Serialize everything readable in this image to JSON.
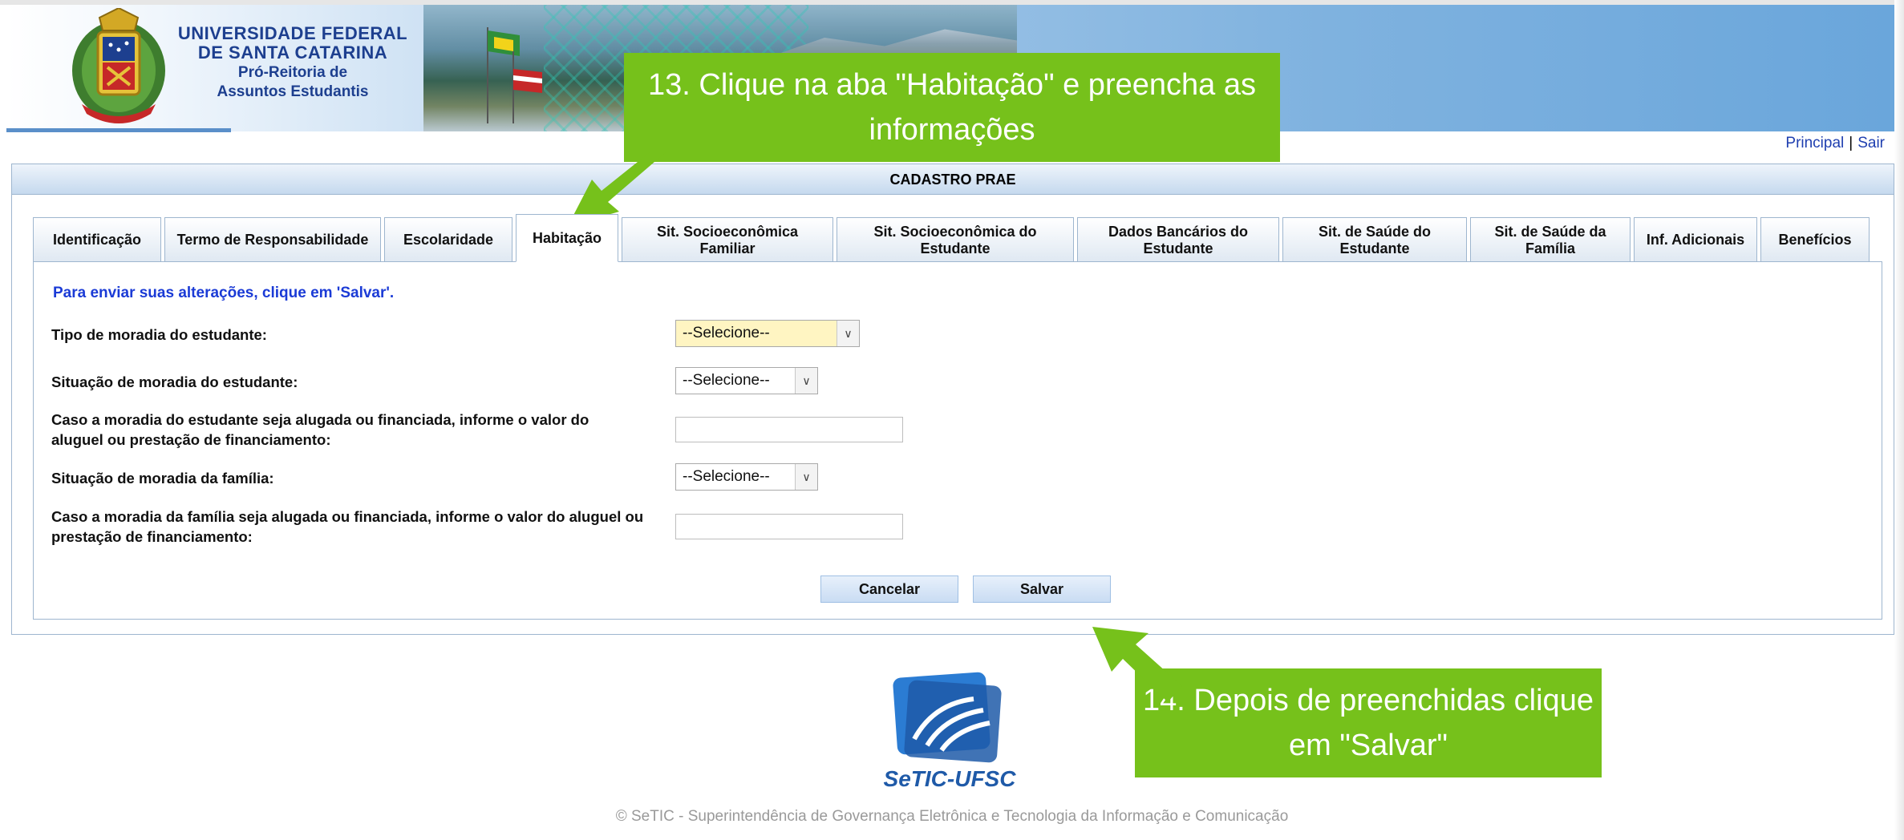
{
  "header": {
    "university_line1": "UNIVERSIDADE FEDERAL",
    "university_line2": "DE SANTA CATARINA",
    "dept_line1": "Pró-Reitoria de",
    "dept_line2": "Assuntos Estudantis"
  },
  "toplinks": {
    "principal": "Principal",
    "separator": "|",
    "sair": "Sair"
  },
  "frame": {
    "title": "CADASTRO PRAE"
  },
  "tabs": [
    {
      "label": "Identificação",
      "active": false
    },
    {
      "label": "Termo de Responsabilidade",
      "active": false
    },
    {
      "label": "Escolaridade",
      "active": false
    },
    {
      "label": "Habitação",
      "active": true
    },
    {
      "label": "Sit. Socioeconômica Familiar",
      "active": false
    },
    {
      "label": "Sit. Socioeconômica do Estudante",
      "active": false
    },
    {
      "label": "Dados Bancários do Estudante",
      "active": false
    },
    {
      "label": "Sit. de Saúde do Estudante",
      "active": false
    },
    {
      "label": "Sit. de Saúde da Família",
      "active": false
    },
    {
      "label": "Inf. Adicionais",
      "active": false
    },
    {
      "label": "Benefícios",
      "active": false
    }
  ],
  "form": {
    "hint": "Para enviar suas alterações, clique em 'Salvar'.",
    "tipo_moradia_label": "Tipo de moradia do estudante:",
    "tipo_moradia_value": "--Selecione--",
    "situacao_estudante_label": "Situação de moradia do estudante:",
    "situacao_estudante_value": "--Selecione--",
    "valor_estudante_label": "Caso a moradia do estudante seja alugada ou financiada, informe o valor do aluguel ou prestação de financiamento:",
    "valor_estudante_value": "",
    "situacao_familia_label": "Situação de moradia da família:",
    "situacao_familia_value": "--Selecione--",
    "valor_familia_label": "Caso a moradia da família seja alugada ou financiada, informe o valor do aluguel ou prestação de financiamento:",
    "valor_familia_value": "",
    "cancel_label": "Cancelar",
    "save_label": "Salvar"
  },
  "callouts": {
    "step13": "13. Clique na aba \"Habitação\" e preencha as informações",
    "step14": "14. Depois de preenchidas clique em \"Salvar\""
  },
  "footer": {
    "logo_label": "SeTIC-UFSC",
    "copyright": "© SeTIC - Superintendência de Governança Eletrônica e Tecnologia da Informação e Comunicação"
  },
  "colors": {
    "callout_green": "#76c11b",
    "link_blue": "#1f3fb0",
    "hint_blue": "#1b3bd6",
    "highlight_select": "#fff5c2"
  }
}
